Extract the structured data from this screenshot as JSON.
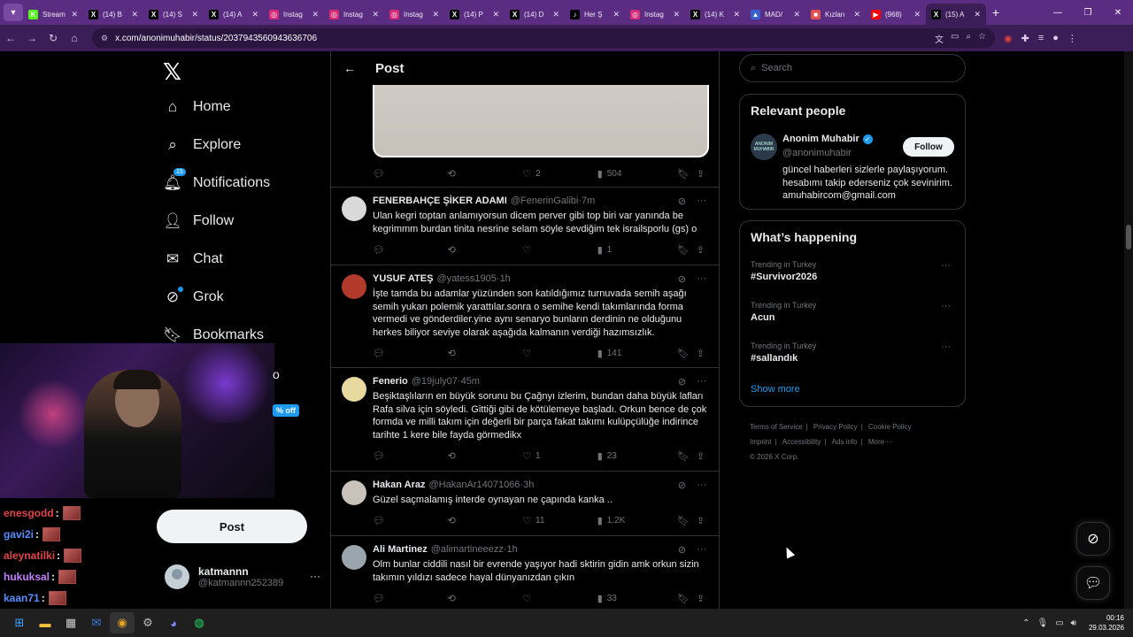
{
  "browser": {
    "tabs": [
      {
        "label": "Stream",
        "icon": "kick-icon",
        "color": "#53fc18",
        "glyph": "K"
      },
      {
        "label": "(14) B",
        "icon": "x-icon",
        "color": "#000000",
        "glyph": "X"
      },
      {
        "label": "(14) S",
        "icon": "x-icon",
        "color": "#000000",
        "glyph": "X"
      },
      {
        "label": "(14) A",
        "icon": "x-icon",
        "color": "#000000",
        "glyph": "X"
      },
      {
        "label": "Instag",
        "icon": "instagram-icon",
        "color": "#d62976",
        "glyph": "◎"
      },
      {
        "label": "Instag",
        "icon": "instagram-icon",
        "color": "#d62976",
        "glyph": "◎"
      },
      {
        "label": "Instag",
        "icon": "instagram-icon",
        "color": "#d62976",
        "glyph": "◎"
      },
      {
        "label": "(14) P",
        "icon": "x-icon",
        "color": "#000000",
        "glyph": "X"
      },
      {
        "label": "(14) D",
        "icon": "x-icon",
        "color": "#000000",
        "glyph": "X"
      },
      {
        "label": "Her Ş",
        "icon": "tiktok-icon",
        "color": "#000000",
        "glyph": "♪"
      },
      {
        "label": "Instag",
        "icon": "instagram-icon",
        "color": "#d62976",
        "glyph": "◎"
      },
      {
        "label": "(14) K",
        "icon": "x-icon",
        "color": "#000000",
        "glyph": "X"
      },
      {
        "label": "MAD/",
        "icon": "site-icon",
        "color": "#3a5fcf",
        "glyph": "▲"
      },
      {
        "label": "Kızları",
        "icon": "site-icon",
        "color": "#e05050",
        "glyph": "■"
      },
      {
        "label": "(968)",
        "icon": "youtube-icon",
        "color": "#ff0000",
        "glyph": "▶"
      },
      {
        "label": "(15) A",
        "icon": "x-icon",
        "color": "#000000",
        "glyph": "X",
        "active": true
      }
    ],
    "url": "x.com/anonimuhabir/status/2037943560943636706"
  },
  "sidebar": {
    "logo": "𝕏",
    "items": [
      {
        "label": "Home",
        "icon": "home-icon",
        "glyph": "⌂"
      },
      {
        "label": "Explore",
        "icon": "search-icon",
        "glyph": "⌕"
      },
      {
        "label": "Notifications",
        "icon": "bell-icon",
        "glyph": "🔔︎",
        "badge": "15"
      },
      {
        "label": "Follow",
        "icon": "add-person-icon",
        "glyph": "👤︎"
      },
      {
        "label": "Chat",
        "icon": "mail-icon",
        "glyph": "✉"
      },
      {
        "label": "Grok",
        "icon": "grok-icon",
        "glyph": "⊘"
      },
      {
        "label": "Bookmarks",
        "icon": "bookmark-icon",
        "glyph": "🔖︎"
      }
    ],
    "partial_item": "o",
    "promo": "% off",
    "post_button": "Post",
    "account": {
      "name": "katmannn",
      "handle": "@katmannn252389",
      "more": "···"
    }
  },
  "chat_overlay": [
    {
      "user": "enesgodd",
      "color": "#e0454a",
      "suffix": ":"
    },
    {
      "user": "gavi2i",
      "color": "#5b8cff",
      "suffix": ":"
    },
    {
      "user": "aleynatilki",
      "color": "#e0454a",
      "suffix": ":"
    },
    {
      "user": "hukuksal",
      "color": "#c080ff",
      "suffix": ":"
    },
    {
      "user": "kaan71",
      "color": "#5b8cff",
      "suffix": ":"
    }
  ],
  "main": {
    "header_title": "Post",
    "top_actions": {
      "likes": "2",
      "views": "504"
    },
    "replies": [
      {
        "name": "FENERBAHÇE ŞİKER ADAMI",
        "handle": "@FenerinGalibi",
        "time": "7m",
        "text": "Ulan kegri toptan anlamıyorsun dicem perver gibi top biri var yanında be kegrimmm burdan tinita nesrine selam söyle sevdiğim tek israilsporlu (gs) o",
        "replies": "",
        "retweets": "",
        "likes": "",
        "views": "1",
        "avatar_color": "#d9d9d9"
      },
      {
        "name": "YUSUF ATEŞ",
        "handle": "@yatess1905",
        "time": "1h",
        "text": "İşte tamda bu adamlar yüzünden son katıldığımız turnuvada semih aşağı semih yukarı polemik yarattılar.sonra o semihe kendi takımlarında forma vermedi ve gönderdiler.yine aynı senaryo bunların derdinin ne olduğunu herkes biliyor seviye olarak aşağıda kalmanın verdiği hazımsızlık.",
        "replies": "",
        "retweets": "",
        "likes": "",
        "views": "141",
        "avatar_color": "#b23a2a"
      },
      {
        "name": "Fenerio",
        "handle": "@19july07",
        "time": "45m",
        "text": "Beşiktaşlıların en büyük sorunu bu Çağnyı izlerim, bundan daha büyük lafları Rafa silva için söyledi. Gittiği gibi de kötülemeye başladı. Orkun bence de çok formda ve milli takım için değerli bir parça fakat takımı kulüpçülüğe indirince tarihte 1 kere bile fayda görmedikx",
        "replies": "",
        "retweets": "",
        "likes": "1",
        "views": "23",
        "avatar_color": "#e8d9a0"
      },
      {
        "name": "Hakan Araz",
        "handle": "@HakanAr14071066",
        "time": "3h",
        "text": "Güzel saçmalamış interde oynayan ne çapında kanka ..",
        "replies": "",
        "retweets": "",
        "likes": "11",
        "views": "1.2K",
        "avatar_color": "#c9c2bb"
      },
      {
        "name": "Ali Martinez",
        "handle": "@alimartineeezz",
        "time": "1h",
        "text": "Olm bunlar ciddili nasıl bir evrende yaşıyor hadi sktirin gidin amk orkun sizin takımın yıldızı sadece hayal dünyanızdan çıkın",
        "replies": "",
        "retweets": "",
        "likes": "",
        "views": "33",
        "avatar_color": "#9aa5ad"
      }
    ]
  },
  "right": {
    "search_placeholder": "Search",
    "relevant_title": "Relevant people",
    "relevant_person": {
      "name": "Anonim Muhabir",
      "handle": "@anonimuhabir",
      "bio": "güncel haberleri sizlerle paylaşıyorum. hesabımı takip ederseniz çok sevinirim. amuhabircom@gmail.com",
      "follow_label": "Follow",
      "avatar_text": "ANONIM MUHABIR"
    },
    "happening_title": "What’s happening",
    "trends": [
      {
        "context": "Trending in Turkey",
        "name": "#Survivor2026"
      },
      {
        "context": "Trending in Turkey",
        "name": "Acun"
      },
      {
        "context": "Trending in Turkey",
        "name": "#sallandık"
      }
    ],
    "show_more": "Show more",
    "footer": [
      "Terms of Service",
      "Privacy Policy",
      "Cookie Policy",
      "Imprint",
      "Accessibility",
      "Ads info",
      "More ···",
      "© 2026 X Corp."
    ]
  },
  "taskbar": {
    "time": "00:16",
    "date": "29.03.2026"
  }
}
